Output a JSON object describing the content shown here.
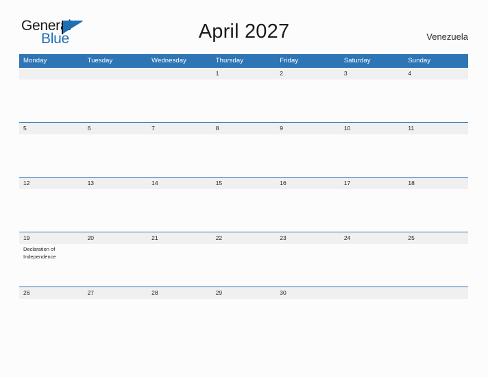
{
  "brand": {
    "name_part1": "General",
    "name_part2": "Blue",
    "triangle_color": "#1f6fb4",
    "text_color": "#1a1a1a"
  },
  "header": {
    "title": "April 2027",
    "region": "Venezuela"
  },
  "theme": {
    "header_blue": "#2e75b6",
    "day_band": "#f0f0f0",
    "page_background": "#fcfcfc",
    "text": "#1f1f1f"
  },
  "calendar": {
    "month": "April",
    "year": "2027",
    "weekday_headers": [
      "Monday",
      "Tuesday",
      "Wednesday",
      "Thursday",
      "Friday",
      "Saturday",
      "Sunday"
    ],
    "weeks": [
      [
        {
          "date": "",
          "events": []
        },
        {
          "date": "",
          "events": []
        },
        {
          "date": "",
          "events": []
        },
        {
          "date": "1",
          "events": []
        },
        {
          "date": "2",
          "events": []
        },
        {
          "date": "3",
          "events": []
        },
        {
          "date": "4",
          "events": []
        }
      ],
      [
        {
          "date": "5",
          "events": []
        },
        {
          "date": "6",
          "events": []
        },
        {
          "date": "7",
          "events": []
        },
        {
          "date": "8",
          "events": []
        },
        {
          "date": "9",
          "events": []
        },
        {
          "date": "10",
          "events": []
        },
        {
          "date": "11",
          "events": []
        }
      ],
      [
        {
          "date": "12",
          "events": []
        },
        {
          "date": "13",
          "events": []
        },
        {
          "date": "14",
          "events": []
        },
        {
          "date": "15",
          "events": []
        },
        {
          "date": "16",
          "events": []
        },
        {
          "date": "17",
          "events": []
        },
        {
          "date": "18",
          "events": []
        }
      ],
      [
        {
          "date": "19",
          "events": [
            "Declaration of Independence"
          ]
        },
        {
          "date": "20",
          "events": []
        },
        {
          "date": "21",
          "events": []
        },
        {
          "date": "22",
          "events": []
        },
        {
          "date": "23",
          "events": []
        },
        {
          "date": "24",
          "events": []
        },
        {
          "date": "25",
          "events": []
        }
      ],
      [
        {
          "date": "26",
          "events": []
        },
        {
          "date": "27",
          "events": []
        },
        {
          "date": "28",
          "events": []
        },
        {
          "date": "29",
          "events": []
        },
        {
          "date": "30",
          "events": []
        },
        {
          "date": "",
          "events": []
        },
        {
          "date": "",
          "events": []
        }
      ]
    ]
  }
}
